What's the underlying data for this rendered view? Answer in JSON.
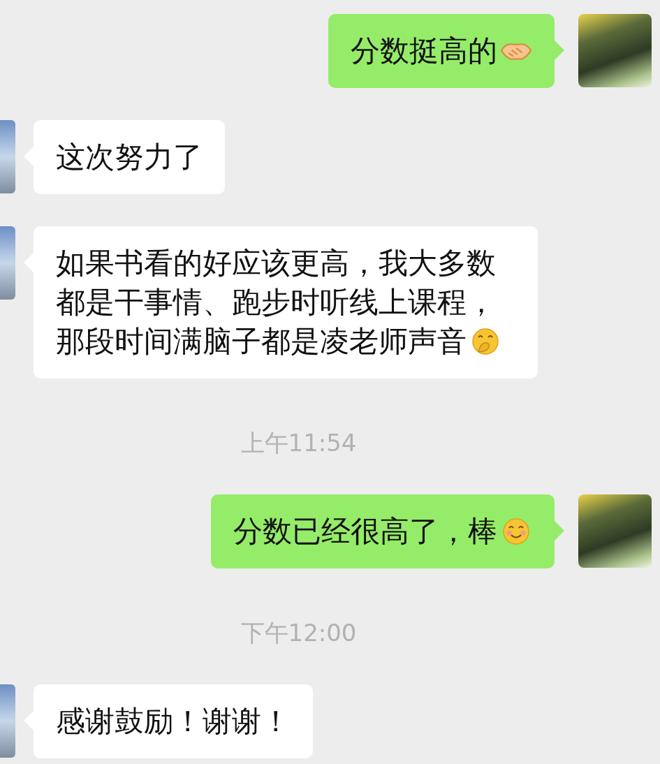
{
  "messages": [
    {
      "kind": "sent",
      "text": "分数挺高的",
      "emoji": {
        "kind": "handshake"
      }
    },
    {
      "kind": "received",
      "text": "这次努力了"
    },
    {
      "kind": "received",
      "text": "如果书看的好应该更高，我大多数都是干事情、跑步时听线上课程，那段时间满脑子都是凌老师声音",
      "emoji": {
        "kind": "hand-over-mouth"
      }
    },
    {
      "kind": "time",
      "text": "上午11:54"
    },
    {
      "kind": "sent",
      "text": "分数已经很高了，棒",
      "emoji": {
        "kind": "smile"
      }
    },
    {
      "kind": "time",
      "text": "下午12:00"
    },
    {
      "kind": "received",
      "text": "感谢鼓励！谢谢！"
    }
  ]
}
